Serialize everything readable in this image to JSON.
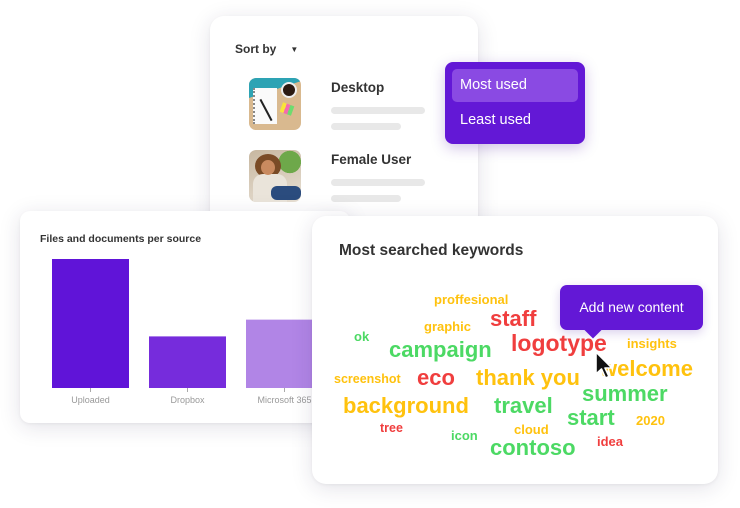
{
  "sort_card": {
    "sort_label": "Sort by",
    "caret": "▼",
    "items": [
      {
        "title": "Desktop",
        "thumb": "desktop-workspace-photo"
      },
      {
        "title": "Female User",
        "thumb": "woman-with-phone-photo"
      },
      {
        "title": "",
        "thumb": "mountain-landscape-photo"
      }
    ]
  },
  "sort_dropdown": {
    "options": [
      {
        "label": "Most used",
        "selected": true
      },
      {
        "label": "Least used",
        "selected": false
      }
    ]
  },
  "chart_data": {
    "type": "bar",
    "title": "Files and documents per source",
    "categories": [
      "Uploaded",
      "Dropbox",
      "Microsoft 365"
    ],
    "values": [
      100,
      40,
      53
    ],
    "colors": [
      "#6014d8",
      "#762cdc",
      "#b185e6"
    ],
    "xlabel": "",
    "ylabel": "",
    "ylim": [
      0,
      100
    ],
    "grid": false
  },
  "keywords": {
    "title": "Most searched keywords",
    "colors": {
      "green": "#4cd964",
      "yellow": "#ffc20e",
      "red": "#f03e3e"
    },
    "words": [
      {
        "text": "proffesional",
        "color": "yellow",
        "weight": 2
      },
      {
        "text": "staff",
        "color": "red",
        "weight": 4
      },
      {
        "text": "graphic",
        "color": "yellow",
        "weight": 2
      },
      {
        "text": "ok",
        "color": "green",
        "weight": 2
      },
      {
        "text": "campaign",
        "color": "green",
        "weight": 4
      },
      {
        "text": "logotype",
        "color": "red",
        "weight": 4
      },
      {
        "text": "insights",
        "color": "yellow",
        "weight": 2
      },
      {
        "text": "screenshot",
        "color": "yellow",
        "weight": 2
      },
      {
        "text": "eco",
        "color": "red",
        "weight": 4
      },
      {
        "text": "thank you",
        "color": "yellow",
        "weight": 4
      },
      {
        "text": "welcome",
        "color": "yellow",
        "weight": 4
      },
      {
        "text": "summer",
        "color": "green",
        "weight": 4
      },
      {
        "text": "background",
        "color": "yellow",
        "weight": 4
      },
      {
        "text": "travel",
        "color": "green",
        "weight": 4
      },
      {
        "text": "start",
        "color": "green",
        "weight": 4
      },
      {
        "text": "2020",
        "color": "yellow",
        "weight": 2
      },
      {
        "text": "tree",
        "color": "red",
        "weight": 2
      },
      {
        "text": "icon",
        "color": "green",
        "weight": 2
      },
      {
        "text": "cloud",
        "color": "yellow",
        "weight": 2
      },
      {
        "text": "idea",
        "color": "red",
        "weight": 2
      },
      {
        "text": "contoso",
        "color": "green",
        "weight": 4
      }
    ]
  },
  "tooltip": {
    "label": "Add new content"
  }
}
